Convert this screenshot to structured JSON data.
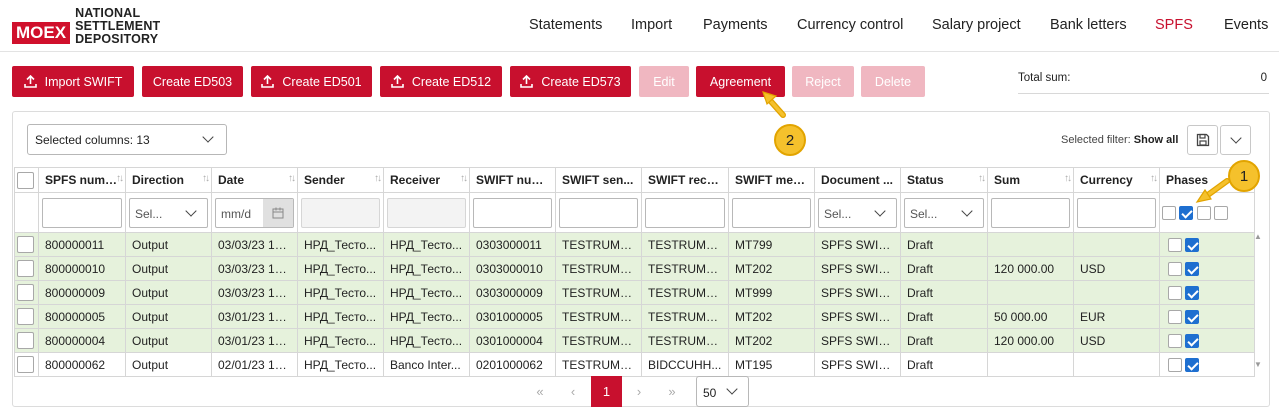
{
  "logo": {
    "badge": "MOEX",
    "line1": "NATIONAL",
    "line2": "SETTLEMENT",
    "line3": "DEPOSITORY"
  },
  "nav": [
    "Statements",
    "Import",
    "Payments",
    "Currency control",
    "Salary project",
    "Bank letters",
    "SPFS",
    "Events"
  ],
  "nav_active": "SPFS",
  "toolbar": {
    "import_swift": "Import SWIFT",
    "create_ed503": "Create ED503",
    "create_ed501": "Create ED501",
    "create_ed512": "Create ED512",
    "create_ed573": "Create ED573",
    "edit": "Edit",
    "agreement": "Agreement",
    "reject": "Reject",
    "delete": "Delete"
  },
  "total": {
    "label": "Total sum:",
    "value": "0"
  },
  "columns_selector": "Selected columns: 13",
  "filter": {
    "label": "Selected filter:",
    "value": "Show all"
  },
  "columns": [
    "SPFS number",
    "Direction",
    "Date",
    "Sender",
    "Receiver",
    "SWIFT num...",
    "SWIFT sen...",
    "SWIFT rece...",
    "SWIFT mes...",
    "Document ...",
    "Status",
    "Sum",
    "Currency",
    "Phases"
  ],
  "filters": {
    "select_placeholder": "Sel...",
    "date_placeholder": "mm/d"
  },
  "rows": [
    {
      "spfs": "800000011",
      "direction": "Output",
      "date": "03/03/23 12...",
      "sender": "НРД_Тесто...",
      "receiver": "НРД_Тесто...",
      "swift_num": "0303000011",
      "swift_sen": "TESTRUMM...",
      "swift_rec": "TESTRUMM...",
      "swift_mes": "MT799",
      "document": "SPFS SWIFT...",
      "status": "Draft",
      "sum": "",
      "currency": ""
    },
    {
      "spfs": "800000010",
      "direction": "Output",
      "date": "03/03/23 12...",
      "sender": "НРД_Тесто...",
      "receiver": "НРД_Тесто...",
      "swift_num": "0303000010",
      "swift_sen": "TESTRUMM...",
      "swift_rec": "TESTRUMM...",
      "swift_mes": "MT202",
      "document": "SPFS SWIFT...",
      "status": "Draft",
      "sum": "120 000.00",
      "currency": "USD"
    },
    {
      "spfs": "800000009",
      "direction": "Output",
      "date": "03/03/23 12...",
      "sender": "НРД_Тесто...",
      "receiver": "НРД_Тесто...",
      "swift_num": "0303000009",
      "swift_sen": "TESTRUMM...",
      "swift_rec": "TESTRUMM...",
      "swift_mes": "MT999",
      "document": "SPFS SWIFT...",
      "status": "Draft",
      "sum": "",
      "currency": ""
    },
    {
      "spfs": "800000005",
      "direction": "Output",
      "date": "03/01/23 16...",
      "sender": "НРД_Тесто...",
      "receiver": "НРД_Тесто...",
      "swift_num": "0301000005",
      "swift_sen": "TESTRUMM...",
      "swift_rec": "TESTRUMM...",
      "swift_mes": "MT202",
      "document": "SPFS SWIFT...",
      "status": "Draft",
      "sum": "50 000.00",
      "currency": "EUR"
    },
    {
      "spfs": "800000004",
      "direction": "Output",
      "date": "03/01/23 16...",
      "sender": "НРД_Тесто...",
      "receiver": "НРД_Тесто...",
      "swift_num": "0301000004",
      "swift_sen": "TESTRUMM...",
      "swift_rec": "TESTRUMM...",
      "swift_mes": "MT202",
      "document": "SPFS SWIFT...",
      "status": "Draft",
      "sum": "120 000.00",
      "currency": "USD"
    },
    {
      "spfs": "800000062",
      "direction": "Output",
      "date": "02/01/23 12...",
      "sender": "НРД_Тесто...",
      "receiver": "Banco Inter...",
      "swift_num": "0201000062",
      "swift_sen": "TESTRUMM...",
      "swift_rec": "BIDCCUHH...",
      "swift_mes": "MT195",
      "document": "SPFS SWIFT...",
      "status": "Draft",
      "sum": "",
      "currency": ""
    }
  ],
  "pagination": {
    "first": "«",
    "prev": "‹",
    "current": "1",
    "next": "›",
    "last": "»",
    "page_size": "50"
  },
  "callouts": {
    "one": "1",
    "two": "2"
  },
  "colors": {
    "brand": "#c8102e",
    "row_highlight": "#e6f2dc",
    "callout": "#f5c12c",
    "checkbox": "#1e6fd0"
  }
}
